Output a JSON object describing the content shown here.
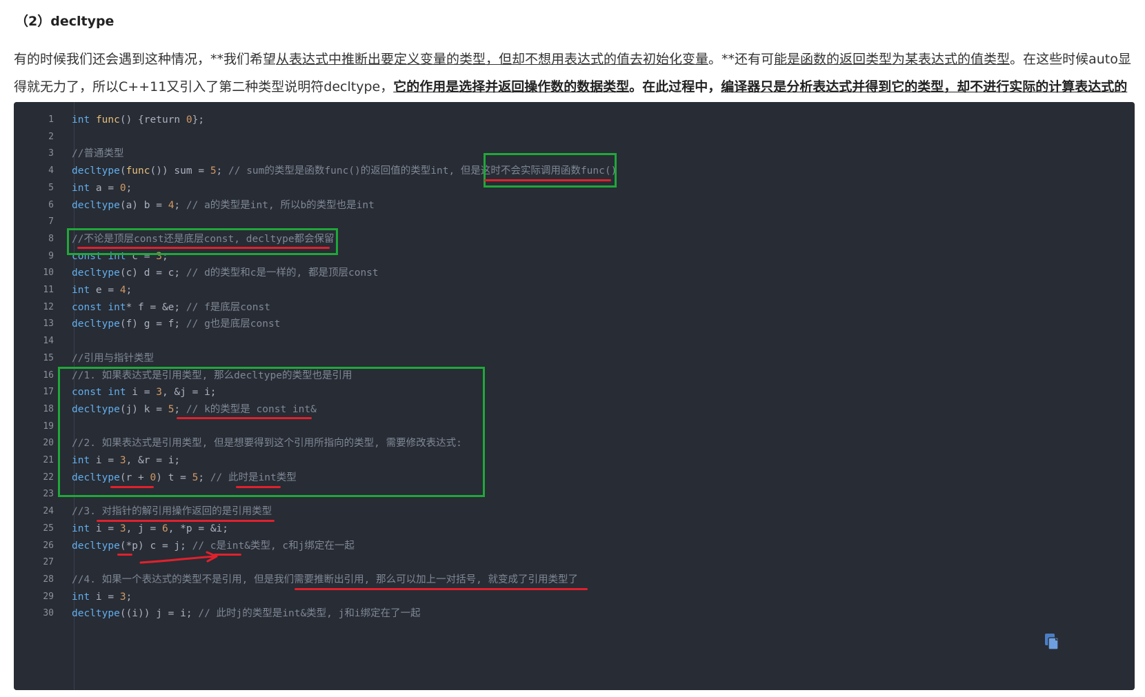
{
  "heading": "（2）decltype",
  "intro": {
    "p1": "有的时候我们还会遇到这种情况，**我们希望",
    "u1": "从表达式中推断出要定义变量的类型，但却不想用表达式的值去初始化变量",
    "p2": "。**还有可",
    "u2": "能是函数的返回类型为某表达式的值类型",
    "p3": "。在这些时候auto显得就无力了，所以C++11又引入了第二种类型说明符decltype，",
    "b1": "它的作用是选择并返回操作数的数据类型",
    "b2": "。在此过程中，",
    "b3": "编译器只是分析表达式并得到它的类型，却不进行实际的计算表达式的值",
    "b4": "。"
  },
  "code": {
    "line_numbers": [
      "1",
      "2",
      "3",
      "4",
      "5",
      "6",
      "7",
      "8",
      "9",
      "10",
      "11",
      "12",
      "13",
      "14",
      "15",
      "16",
      "17",
      "18",
      "19",
      "20",
      "21",
      "22",
      "23",
      "24",
      "25",
      "26",
      "27",
      "28",
      "29",
      "30"
    ],
    "lines": [
      [
        {
          "t": "int",
          "c": "kw"
        },
        {
          "t": " "
        },
        {
          "t": "func",
          "c": "fn"
        },
        {
          "t": "() {return "
        },
        {
          "t": "0",
          "c": "num"
        },
        {
          "t": "};"
        }
      ],
      [],
      [
        {
          "t": "//普通类型",
          "c": "cm"
        }
      ],
      [
        {
          "t": "decltype",
          "c": "kw"
        },
        {
          "t": "("
        },
        {
          "t": "func",
          "c": "fn"
        },
        {
          "t": "()) sum = "
        },
        {
          "t": "5",
          "c": "num"
        },
        {
          "t": "; "
        },
        {
          "t": "// sum的类型是函数func()的返回值的类型int, 但是这时不会实际调用函数func()",
          "c": "cm"
        }
      ],
      [
        {
          "t": "int",
          "c": "kw"
        },
        {
          "t": " a = "
        },
        {
          "t": "0",
          "c": "num"
        },
        {
          "t": ";"
        }
      ],
      [
        {
          "t": "decltype",
          "c": "kw"
        },
        {
          "t": "(a) b = "
        },
        {
          "t": "4",
          "c": "num"
        },
        {
          "t": "; "
        },
        {
          "t": "// a的类型是int, 所以b的类型也是int",
          "c": "cm"
        }
      ],
      [],
      [
        {
          "t": "//不论是顶层const还是底层const, decltype都会保留",
          "c": "cm"
        }
      ],
      [
        {
          "t": "const int",
          "c": "kw"
        },
        {
          "t": " c = "
        },
        {
          "t": "3",
          "c": "num"
        },
        {
          "t": ";"
        }
      ],
      [
        {
          "t": "decltype",
          "c": "kw"
        },
        {
          "t": "(c) d = c; "
        },
        {
          "t": "// d的类型和c是一样的, 都是顶层const",
          "c": "cm"
        }
      ],
      [
        {
          "t": "int",
          "c": "kw"
        },
        {
          "t": " e = "
        },
        {
          "t": "4",
          "c": "num"
        },
        {
          "t": ";"
        }
      ],
      [
        {
          "t": "const int",
          "c": "kw"
        },
        {
          "t": "* f = &e; "
        },
        {
          "t": "// f是底层const",
          "c": "cm"
        }
      ],
      [
        {
          "t": "decltype",
          "c": "kw"
        },
        {
          "t": "(f) g = f; "
        },
        {
          "t": "// g也是底层const",
          "c": "cm"
        }
      ],
      [],
      [
        {
          "t": "//引用与指针类型",
          "c": "cm"
        }
      ],
      [
        {
          "t": "//1. 如果表达式是引用类型, 那么decltype的类型也是引用",
          "c": "cm"
        }
      ],
      [
        {
          "t": "const int",
          "c": "kw"
        },
        {
          "t": " i = "
        },
        {
          "t": "3",
          "c": "num"
        },
        {
          "t": ", &j = i;"
        }
      ],
      [
        {
          "t": "decltype",
          "c": "kw"
        },
        {
          "t": "(j) k = "
        },
        {
          "t": "5",
          "c": "num"
        },
        {
          "t": "; "
        },
        {
          "t": "// k的类型是 const int&",
          "c": "cm"
        }
      ],
      [],
      [
        {
          "t": "//2. 如果表达式是引用类型, 但是想要得到这个引用所指向的类型, 需要修改表达式:",
          "c": "cm"
        }
      ],
      [
        {
          "t": "int",
          "c": "kw"
        },
        {
          "t": " i = "
        },
        {
          "t": "3",
          "c": "num"
        },
        {
          "t": ", &r = i;"
        }
      ],
      [
        {
          "t": "decltype",
          "c": "kw"
        },
        {
          "t": "(r + "
        },
        {
          "t": "0",
          "c": "num"
        },
        {
          "t": ") t = "
        },
        {
          "t": "5",
          "c": "num"
        },
        {
          "t": "; "
        },
        {
          "t": "// 此时是int类型",
          "c": "cm"
        }
      ],
      [],
      [
        {
          "t": "//3. 对指针的解引用操作返回的是引用类型",
          "c": "cm"
        }
      ],
      [
        {
          "t": "int",
          "c": "kw"
        },
        {
          "t": " i = "
        },
        {
          "t": "3",
          "c": "num"
        },
        {
          "t": ", j = "
        },
        {
          "t": "6",
          "c": "num"
        },
        {
          "t": ", *p = &i;"
        }
      ],
      [
        {
          "t": "decltype",
          "c": "kw"
        },
        {
          "t": "(*p) c = j; "
        },
        {
          "t": "// c是int&类型, c和j绑定在一起",
          "c": "cm"
        }
      ],
      [],
      [
        {
          "t": "//4. 如果一个表达式的类型不是引用, 但是我们需要推断出引用, 那么可以加上一对括号, 就变成了引用类型了",
          "c": "cm"
        }
      ],
      [
        {
          "t": "int",
          "c": "kw"
        },
        {
          "t": " i = "
        },
        {
          "t": "3",
          "c": "num"
        },
        {
          "t": ";"
        }
      ],
      [
        {
          "t": "decltype",
          "c": "kw"
        },
        {
          "t": "((i)) j = i; "
        },
        {
          "t": "// 此时j的类型是int&类型, j和i绑定在了一起",
          "c": "cm"
        }
      ]
    ]
  },
  "colors": {
    "code_bg": "#282c34",
    "keyword": "#61afef",
    "function": "#e5c07b",
    "number": "#d19a66",
    "comment": "#7f8896",
    "annotation_green": "#1fa83a",
    "annotation_red": "#e0212d"
  },
  "icons": {
    "copy": "copy-icon"
  }
}
